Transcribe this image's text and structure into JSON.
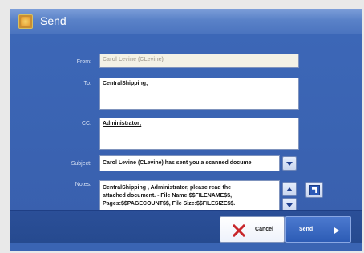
{
  "window": {
    "title": "Send",
    "icon": "app-icon"
  },
  "form": {
    "from": {
      "label": "From:",
      "value": "Carol Levine (CLevine)"
    },
    "to": {
      "label": "To:",
      "value": "CentralShipping;"
    },
    "cc": {
      "label": "CC:",
      "value": "Administrator;"
    },
    "subject": {
      "label": "Subject:",
      "value": "Carol Levine (CLevine) has sent you a scanned docume"
    },
    "notes": {
      "label": "Notes:",
      "line1": "CentralShipping , Administrator, please read the",
      "line2": "attached document. - File Name:$$FILENAME$$,",
      "line3": "Pages:$$PAGECOUNT$$, File Size:$$FILESIZE$$."
    }
  },
  "buttons": {
    "cancel": "Cancel",
    "send": "Send"
  },
  "colors": {
    "window_bg": "#3a64b3",
    "titlebar": "#5a82c8",
    "footer": "#264a8f",
    "send_button": "#2d5cb5"
  }
}
